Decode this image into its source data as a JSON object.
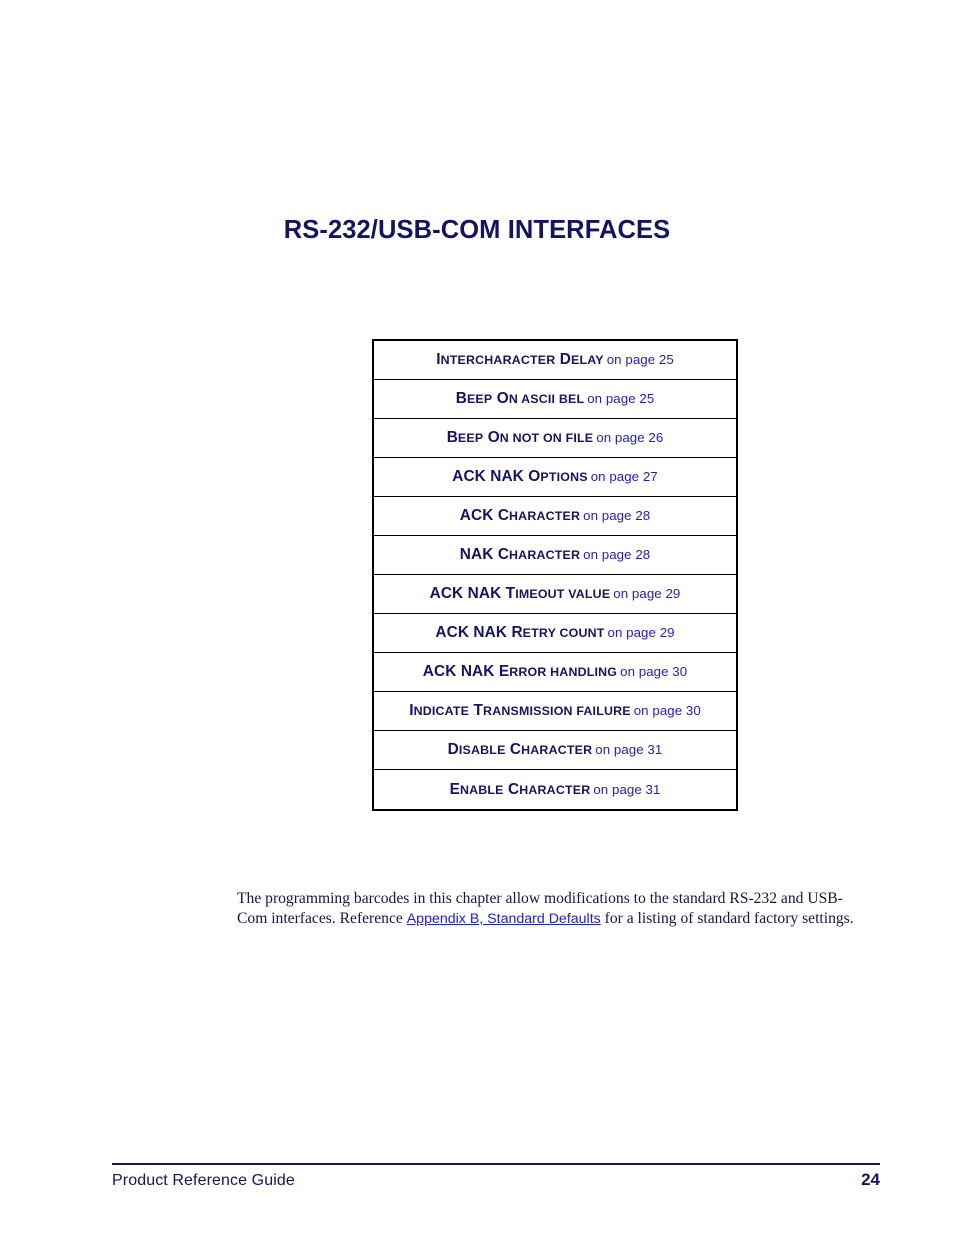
{
  "page": {
    "title": "RS-232/USB-COM INTERFACES",
    "accent_color": "#141464",
    "link_color": "#2020cf"
  },
  "link_table": {
    "rows": [
      {
        "head": "I",
        "head_rest": "NTERCHARACTER",
        "head2": "D",
        "head2_rest": "ELAY",
        "full_label": "Intercharacter Delay",
        "page_ref": "on page 25"
      },
      {
        "head": "B",
        "head_rest": "EEP",
        "head2": "O",
        "head2_rest": "N ASCII BEL",
        "full_label": "Beep On ASCII BEL",
        "page_ref": "on page 25"
      },
      {
        "head": "B",
        "head_rest": "EEP",
        "head2": "O",
        "head2_rest": "N NOT ON FILE",
        "full_label": "Beep On Not on File",
        "page_ref": "on page 26"
      },
      {
        "head": "ACK NAK ",
        "head_rest": "",
        "head2": "O",
        "head2_rest": "PTIONS",
        "full_label": "ACK NAK Options",
        "page_ref": "on page 27"
      },
      {
        "head": "ACK ",
        "head_rest": "",
        "head2": "C",
        "head2_rest": "HARACTER",
        "full_label": "ACK Character",
        "page_ref": "on page 28"
      },
      {
        "head": "NAK ",
        "head_rest": "",
        "head2": "C",
        "head2_rest": "HARACTER",
        "full_label": "NAK Character",
        "page_ref": "on page 28"
      },
      {
        "head": "ACK NAK ",
        "head_rest": "",
        "head2": "T",
        "head2_rest": "IMEOUT VALUE",
        "full_label": "ACK NAK Timeout Value",
        "page_ref": "on page 29"
      },
      {
        "head": "ACK NAK ",
        "head_rest": "",
        "head2": "R",
        "head2_rest": "ETRY COUNT",
        "full_label": "ACK NAK Retry Count",
        "page_ref": "on page 29"
      },
      {
        "head": "ACK NAK ",
        "head_rest": "",
        "head2": "E",
        "head2_rest": "RROR HANDLING",
        "full_label": "ACK NAK Error Handling",
        "page_ref": "on page 30"
      },
      {
        "head": "I",
        "head_rest": "NDICATE",
        "head2": "T",
        "head2_rest": "RANSMISSION FAILURE",
        "full_label": "Indicate Transmission Failure",
        "page_ref": "on page 30"
      },
      {
        "head": "D",
        "head_rest": "ISABLE",
        "head2": "C",
        "head2_rest": "HARACTER",
        "full_label": "Disable Character",
        "page_ref": "on page 31"
      },
      {
        "head": "E",
        "head_rest": "NABLE",
        "head2": "C",
        "head2_rest": "HARACTER",
        "full_label": "Enable Character",
        "page_ref": "on page 31"
      }
    ]
  },
  "body": {
    "text_before_link": "The programming barcodes in this chapter allow modifications to the standard RS-232 and USB-Com interfaces. Reference ",
    "link_text": "Appendix B, Standard Defaults",
    "text_after_link": " for a listing of standard factory settings."
  },
  "footer": {
    "left_label": "Product Reference Guide",
    "page_number": "24"
  }
}
